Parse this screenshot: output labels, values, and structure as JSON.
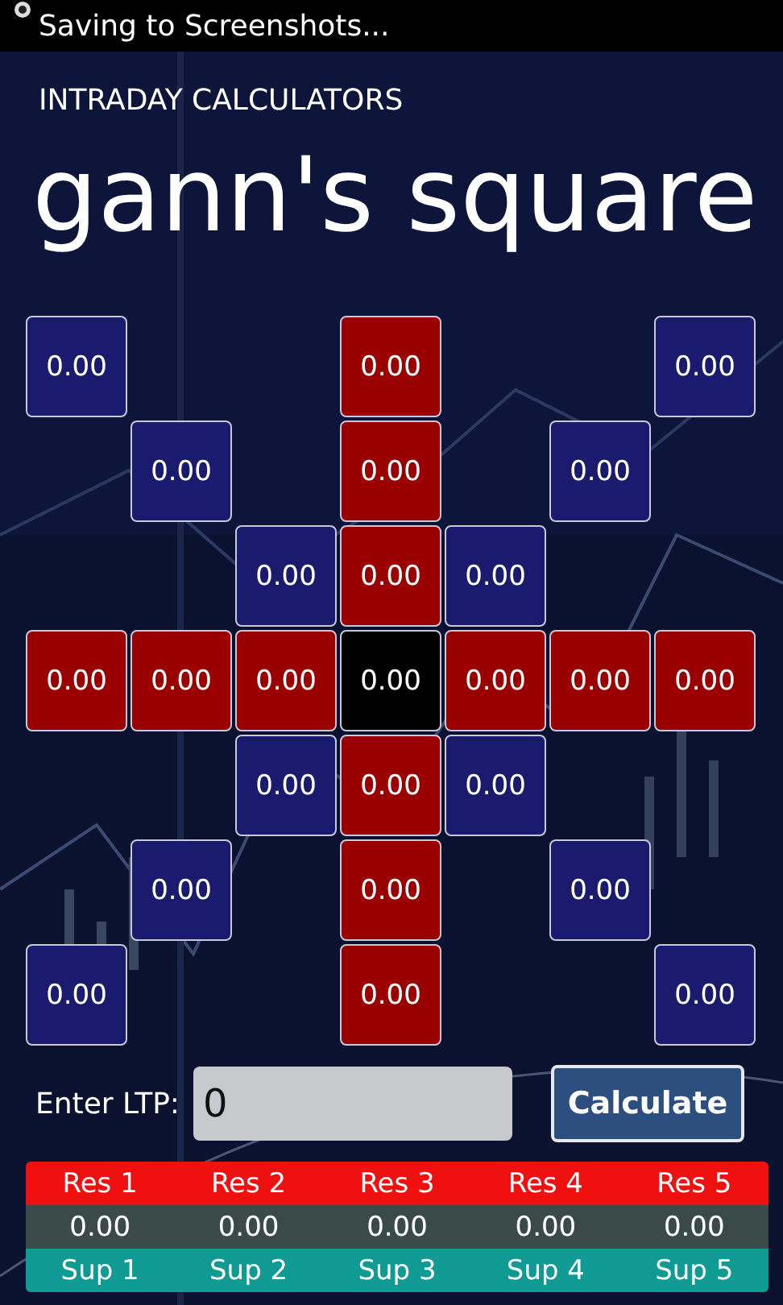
{
  "status_bar": {
    "text": "Saving to Screenshots..."
  },
  "app_title": "INTRADAY CALCULATORS",
  "page_title": "gann's square",
  "grid": [
    [
      {
        "kind": "blue",
        "value": "0.00"
      },
      {
        "kind": "blank"
      },
      {
        "kind": "blank"
      },
      {
        "kind": "red",
        "value": "0.00"
      },
      {
        "kind": "blank"
      },
      {
        "kind": "blank"
      },
      {
        "kind": "blue",
        "value": "0.00"
      }
    ],
    [
      {
        "kind": "blank"
      },
      {
        "kind": "blue",
        "value": "0.00"
      },
      {
        "kind": "blank"
      },
      {
        "kind": "red",
        "value": "0.00"
      },
      {
        "kind": "blank"
      },
      {
        "kind": "blue",
        "value": "0.00"
      },
      {
        "kind": "blank"
      }
    ],
    [
      {
        "kind": "blank"
      },
      {
        "kind": "blank"
      },
      {
        "kind": "blue",
        "value": "0.00"
      },
      {
        "kind": "red",
        "value": "0.00"
      },
      {
        "kind": "blue",
        "value": "0.00"
      },
      {
        "kind": "blank"
      },
      {
        "kind": "blank"
      }
    ],
    [
      {
        "kind": "red",
        "value": "0.00"
      },
      {
        "kind": "red",
        "value": "0.00"
      },
      {
        "kind": "red",
        "value": "0.00"
      },
      {
        "kind": "center",
        "value": "0.00"
      },
      {
        "kind": "red",
        "value": "0.00"
      },
      {
        "kind": "red",
        "value": "0.00"
      },
      {
        "kind": "red",
        "value": "0.00"
      }
    ],
    [
      {
        "kind": "blank"
      },
      {
        "kind": "blank"
      },
      {
        "kind": "blue",
        "value": "0.00"
      },
      {
        "kind": "red",
        "value": "0.00"
      },
      {
        "kind": "blue",
        "value": "0.00"
      },
      {
        "kind": "blank"
      },
      {
        "kind": "blank"
      }
    ],
    [
      {
        "kind": "blank"
      },
      {
        "kind": "blue",
        "value": "0.00"
      },
      {
        "kind": "blank"
      },
      {
        "kind": "red",
        "value": "0.00"
      },
      {
        "kind": "blank"
      },
      {
        "kind": "blue",
        "value": "0.00"
      },
      {
        "kind": "blank"
      }
    ],
    [
      {
        "kind": "blue",
        "value": "0.00"
      },
      {
        "kind": "blank"
      },
      {
        "kind": "blank"
      },
      {
        "kind": "red",
        "value": "0.00"
      },
      {
        "kind": "blank"
      },
      {
        "kind": "blank"
      },
      {
        "kind": "blue",
        "value": "0.00"
      }
    ]
  ],
  "ltp": {
    "label": "Enter LTP:",
    "value": "0"
  },
  "calculate_button": "Calculate",
  "levels_table": {
    "rows": [
      {
        "kind": "resistance",
        "cells": [
          "Res 1",
          "Res 2",
          "Res 3",
          "Res 4",
          "Res 5"
        ]
      },
      {
        "kind": "value",
        "cells": [
          "0.00",
          "0.00",
          "0.00",
          "0.00",
          "0.00"
        ]
      },
      {
        "kind": "support",
        "cells": [
          "Sup 1",
          "Sup 2",
          "Sup 3",
          "Sup 4",
          "Sup 5"
        ]
      }
    ]
  }
}
